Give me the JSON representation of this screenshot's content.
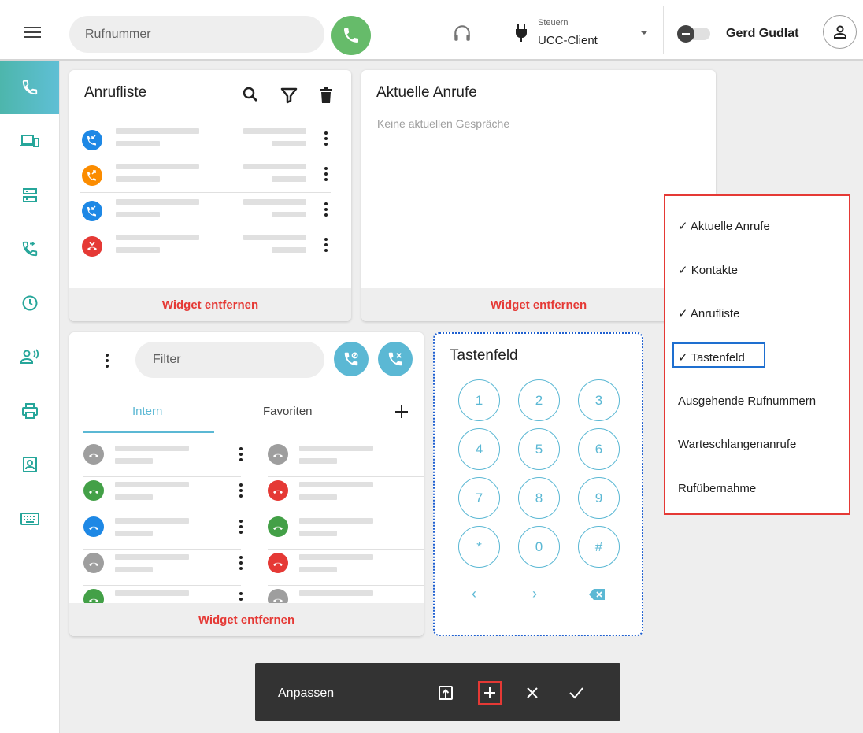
{
  "topbar": {
    "search_placeholder": "Rufnummer",
    "control_label": "Steuern",
    "control_value": "UCC-Client",
    "username": "Gerd Gudlat"
  },
  "sidebar": {
    "items": [
      {
        "icon": "phone-icon",
        "active": true
      },
      {
        "icon": "devices-icon",
        "active": false
      },
      {
        "icon": "server-icon",
        "active": false
      },
      {
        "icon": "call-forward-icon",
        "active": false
      },
      {
        "icon": "clock-icon",
        "active": false
      },
      {
        "icon": "user-voice-icon",
        "active": false
      },
      {
        "icon": "printer-icon",
        "active": false
      },
      {
        "icon": "contact-card-icon",
        "active": false
      },
      {
        "icon": "keyboard-icon",
        "active": false
      }
    ]
  },
  "anrufliste": {
    "title": "Anrufliste",
    "footer": "Widget entfernen",
    "rows": [
      {
        "type": "incoming",
        "color": "#1e88e5"
      },
      {
        "type": "outgoing",
        "color": "#fb8c00"
      },
      {
        "type": "incoming",
        "color": "#1e88e5"
      },
      {
        "type": "missed",
        "color": "#e53935"
      }
    ]
  },
  "aktuelle": {
    "title": "Aktuelle Anrufe",
    "empty_text": "Keine aktuellen Gespräche",
    "footer": "Widget entfernen"
  },
  "kontakte": {
    "filter_placeholder": "Filter",
    "tabs": [
      "Intern",
      "Favoriten"
    ],
    "footer": "Widget entfernen",
    "left_colors": [
      "#9e9e9e",
      "#43a047",
      "#1e88e5",
      "#9e9e9e",
      "#43a047"
    ],
    "right_colors": [
      "#9e9e9e",
      "#e53935",
      "#43a047",
      "#e53935",
      "#9e9e9e"
    ]
  },
  "tastenfeld": {
    "title": "Tastenfeld",
    "keys": [
      "1",
      "2",
      "3",
      "4",
      "5",
      "6",
      "7",
      "8",
      "9",
      "*",
      "0",
      "#"
    ],
    "nav": [
      "‹",
      "›"
    ]
  },
  "menu": {
    "items": [
      "✓ Aktuelle Anrufe",
      "✓ Kontakte",
      "✓ Anrufliste",
      "✓ Tastenfeld",
      "Ausgehende Rufnummern",
      "Warteschlangenanrufe",
      "Rufübernahme"
    ]
  },
  "bottombar": {
    "label": "Anpassen"
  },
  "colors": {
    "accent": "#5bb8d4",
    "remove": "#e53935",
    "call": "#66bb6a"
  }
}
